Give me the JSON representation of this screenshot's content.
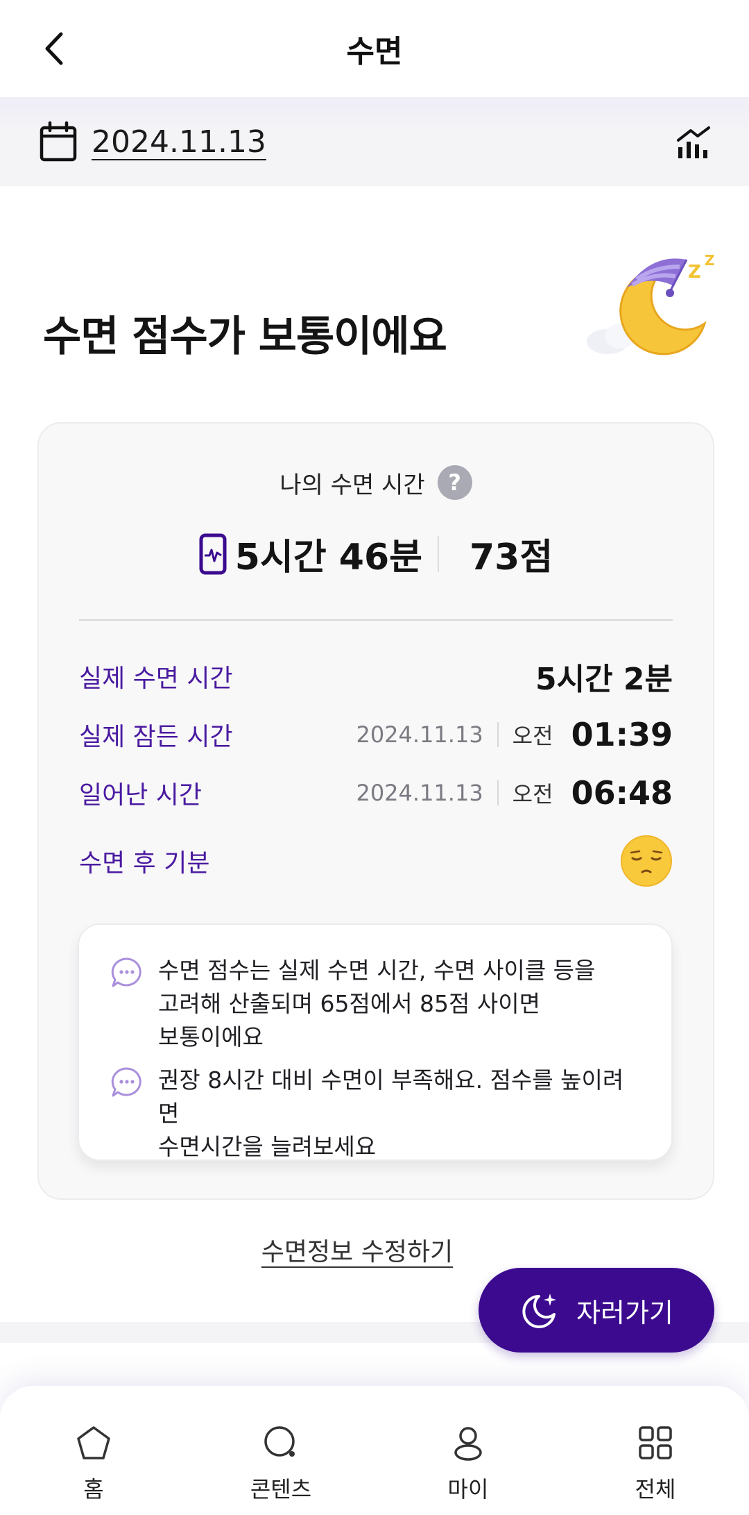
{
  "header": {
    "title": "수면",
    "back_icon": "chevron-left-icon"
  },
  "date_bar": {
    "date": "2024.11.13",
    "calendar_icon": "calendar-icon",
    "stats_icon": "bar-chart-icon"
  },
  "headline": "수면 점수가 보통이에요",
  "card": {
    "title": "나의 수면 시간",
    "help_icon": "?",
    "duration": "5시간 46분",
    "score": "73점",
    "rows": [
      {
        "label": "실제 수면 시간",
        "value": "5시간 2분"
      },
      {
        "label": "실제 잠든 시간",
        "date": "2024.11.13",
        "ampm": "오전",
        "time": "01:39"
      },
      {
        "label": "일어난 시간",
        "date": "2024.11.13",
        "ampm": "오전",
        "time": "06:48"
      },
      {
        "label": "수면 후 기분",
        "mood_icon": "sleepy-face-icon"
      }
    ],
    "tips": [
      "수면 점수는 실제 수면 시간, 수면 사이클 등을\n고려해 산출되며 65점에서 85점 사이면\n보통이에요",
      "권장 8시간 대비 수면이 부족해요. 점수를 높이려면\n수면시간을 늘려보세요"
    ]
  },
  "edit_link": "수면정보 수정하기",
  "sleep_button": "자러가기",
  "bottom_nav": [
    {
      "label": "홈",
      "icon": "home-icon"
    },
    {
      "label": "콘텐츠",
      "icon": "search-icon"
    },
    {
      "label": "마이",
      "icon": "user-icon"
    },
    {
      "label": "전체",
      "icon": "grid-icon"
    }
  ],
  "colors": {
    "accent": "#3b0a8f",
    "label_purple": "#4a1aa0"
  }
}
